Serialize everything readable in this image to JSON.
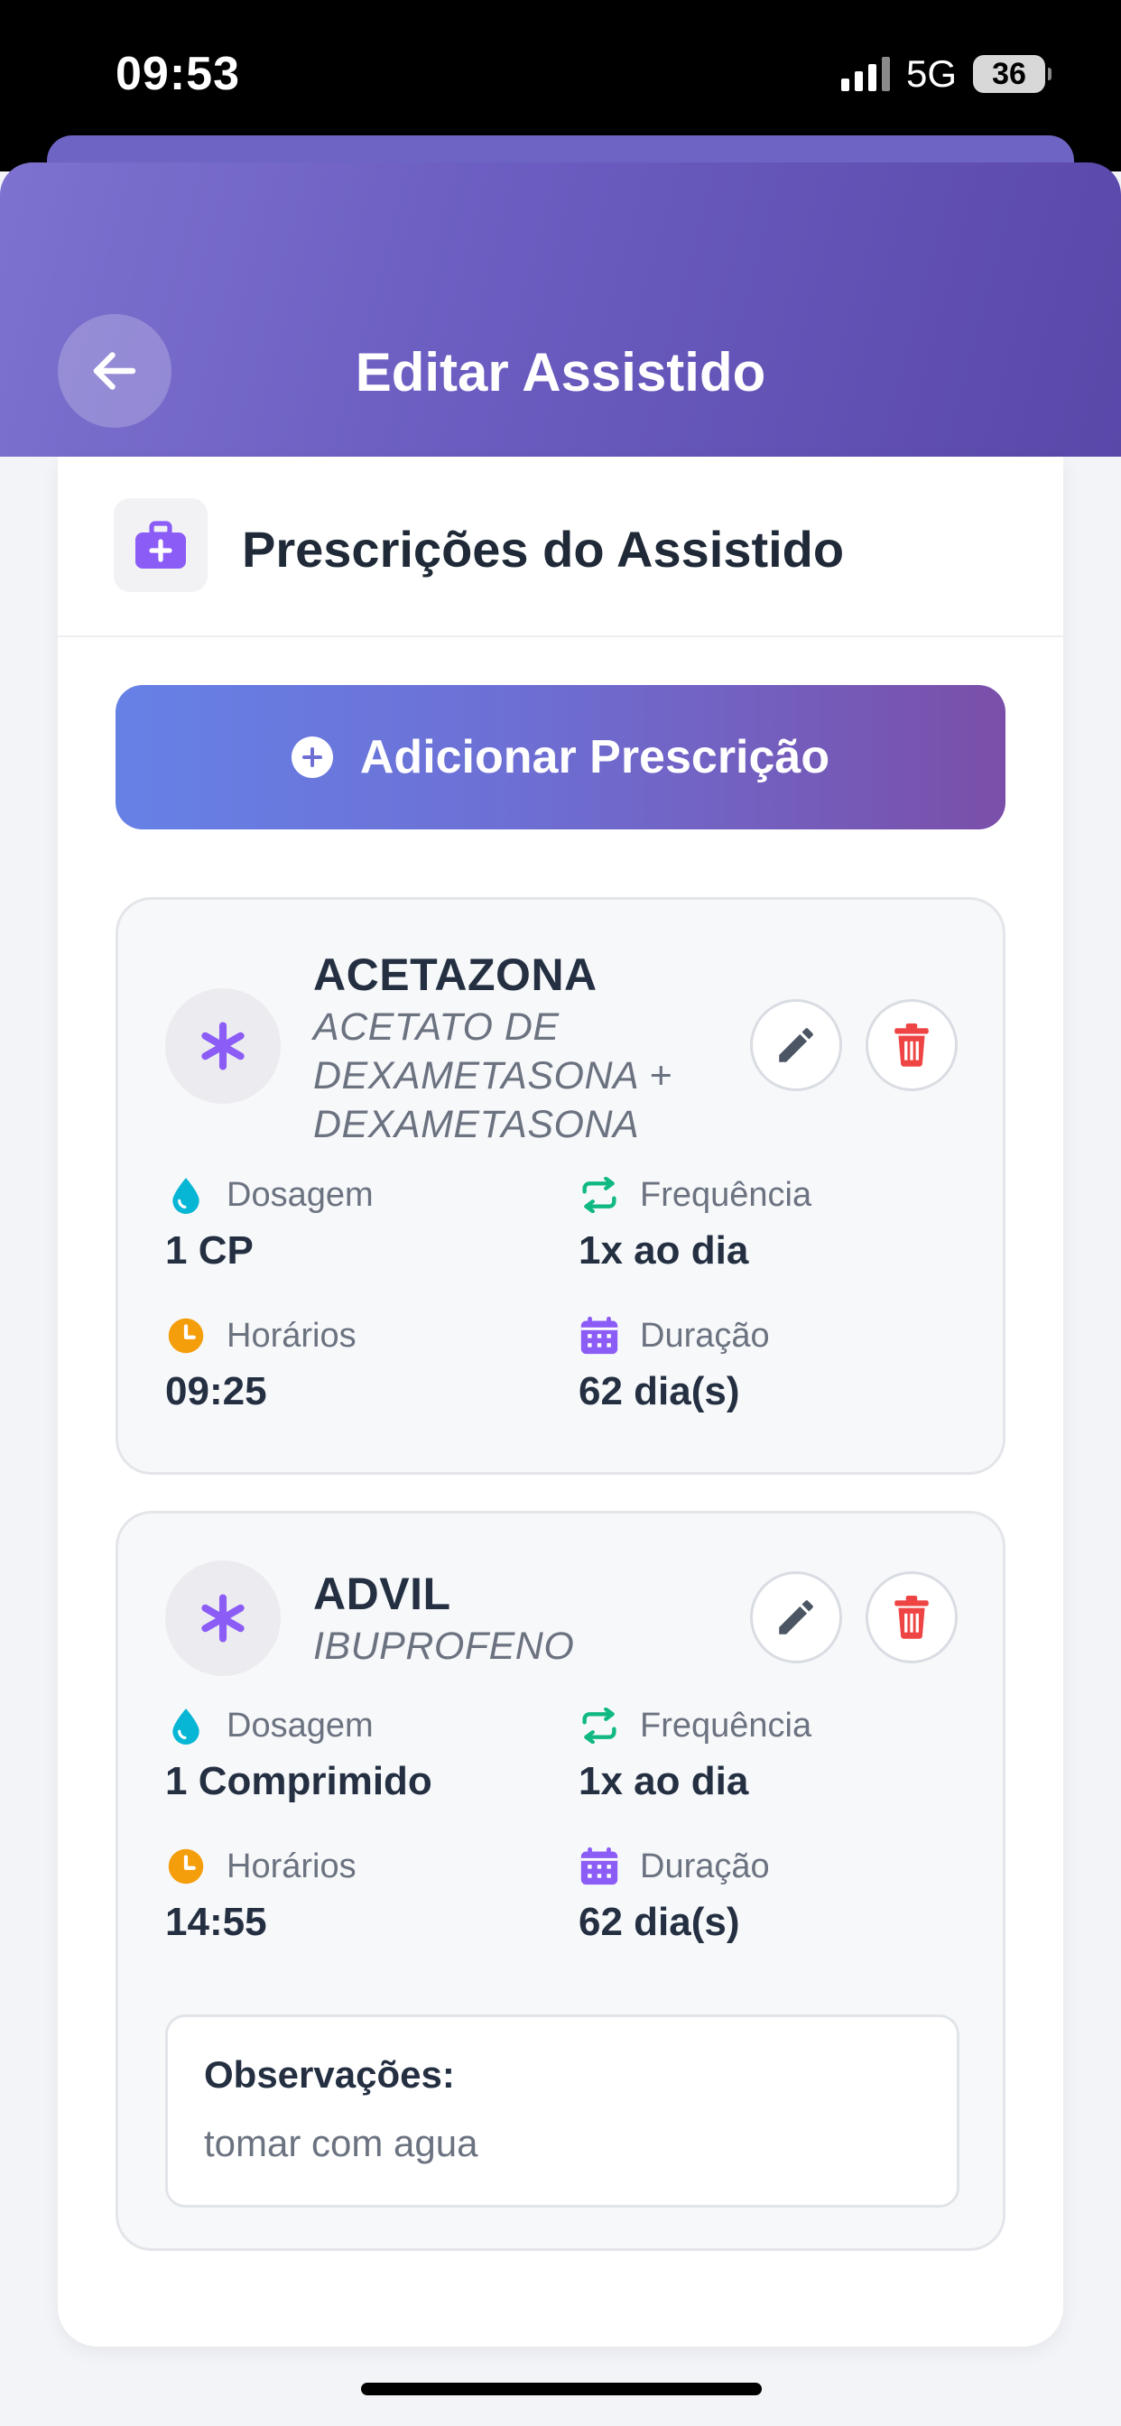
{
  "status_bar": {
    "time": "09:53",
    "network": "5G",
    "battery": "36"
  },
  "header": {
    "title": "Editar Assistido",
    "back_icon": "arrow-left-icon"
  },
  "section": {
    "title": "Prescrições do Assistido",
    "icon": "medical-kit-icon"
  },
  "add_button": {
    "label": "Adicionar Prescrição",
    "icon": "plus-circle-icon"
  },
  "labels": {
    "dosage": "Dosagem",
    "frequency": "Frequência",
    "times": "Horários",
    "duration": "Duração",
    "notes": "Observações:"
  },
  "prescriptions": [
    {
      "name": "ACETAZONA",
      "generic": "ACETATO DE DEXAMETASONA + DEXAMETASONA",
      "dosage": "1 CP",
      "frequency": "1x ao dia",
      "times": "09:25",
      "duration": "62 dia(s)"
    },
    {
      "name": "ADVIL",
      "generic": "IBUPROFENO",
      "dosage": "1 Comprimido",
      "frequency": "1x ao dia",
      "times": "14:55",
      "duration": "62 dia(s)",
      "notes": "tomar com agua"
    }
  ],
  "colors": {
    "header_start": "#7d72cf",
    "header_end": "#5a48a9",
    "accent_purple": "#8b5cf6",
    "dosage_icon": "#06b6d4",
    "frequency_icon": "#10b981",
    "times_icon": "#f59e0b",
    "duration_icon": "#8b5cf6",
    "delete_icon": "#ef4444"
  }
}
